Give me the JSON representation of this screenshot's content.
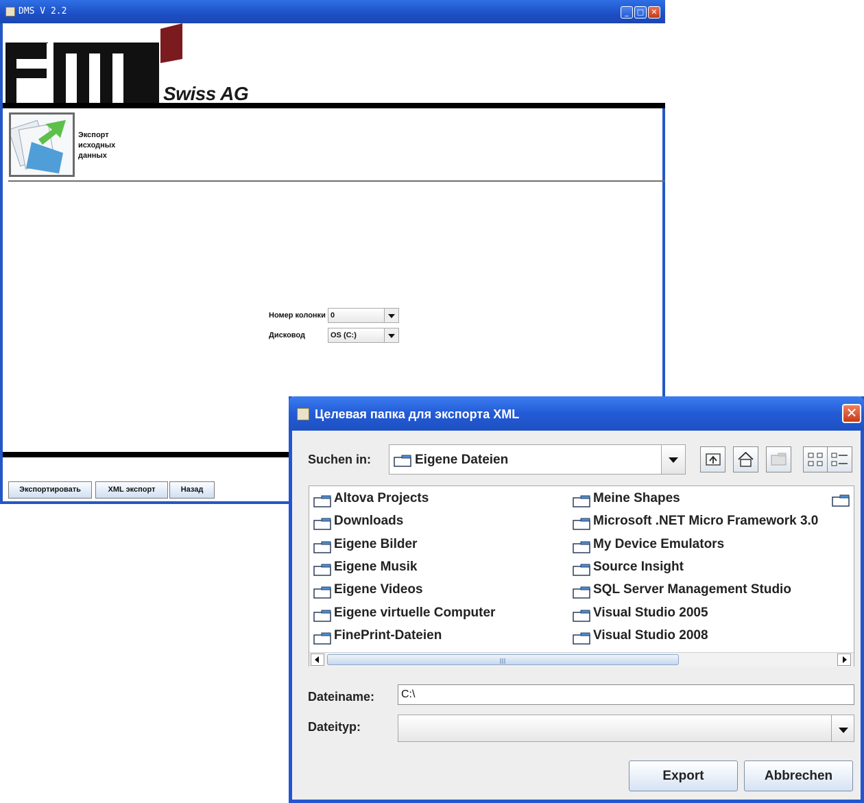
{
  "main_window": {
    "title": "DMS V 2.2",
    "logo_subtitle": "Swiss AG",
    "action_label": "Экспорт исходных данных",
    "form": {
      "column_label": "Номер колонки",
      "column_value": "0",
      "drive_label": "Дисковод",
      "drive_value": "OS (C:)"
    },
    "buttons": {
      "export": "Экспортировать",
      "xml_export": "XML экспорт",
      "back": "Назад"
    }
  },
  "dialog": {
    "title": "Целевая папка для экспорта XML",
    "look_in_label": "Suchen in:",
    "look_in_value": "Eigene Dateien",
    "folders_col1": [
      "Altova Projects",
      "Downloads",
      "Eigene Bilder",
      "Eigene Musik",
      "Eigene Videos",
      "Eigene virtuelle Computer",
      "FinePrint-Dateien"
    ],
    "folders_col2": [
      "Meine Shapes",
      "Microsoft .NET Micro Framework 3.0",
      "My Device Emulators",
      "Source Insight",
      "SQL Server Management Studio",
      "Visual Studio 2005",
      "Visual Studio 2008"
    ],
    "filename_label": "Dateiname:",
    "filename_value": "C:\\",
    "filetype_label": "Dateityp:",
    "filetype_value": "",
    "export_button": "Export",
    "cancel_button": "Abbrechen"
  },
  "colors": {
    "titlebar_blue": "#2357c7",
    "logo_red": "#7b1a1f",
    "dialog_bg": "#eeeeee"
  }
}
